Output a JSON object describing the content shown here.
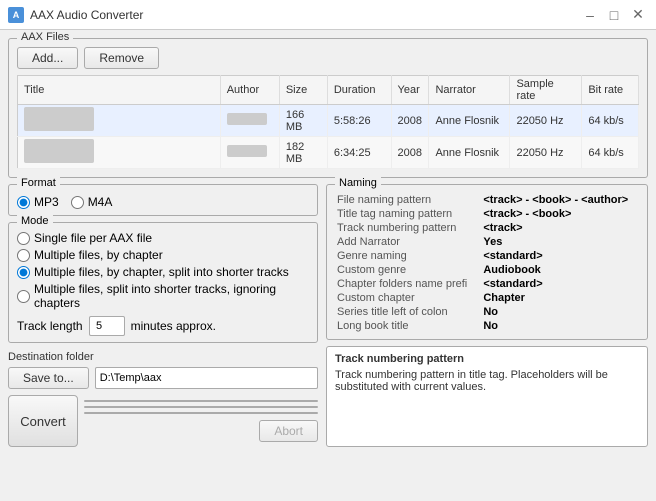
{
  "titleBar": {
    "title": "AAX Audio Converter",
    "icon": "A",
    "minimizeLabel": "–",
    "maximizeLabel": "□",
    "closeLabel": "✕"
  },
  "aaxFiles": {
    "groupLabel": "AAX Files",
    "addButton": "Add...",
    "removeButton": "Remove"
  },
  "table": {
    "columns": [
      "Title",
      "Author",
      "Size",
      "Duration",
      "Year",
      "Narrator",
      "Sample rate",
      "Bit rate"
    ],
    "rows": [
      {
        "title": "",
        "author": "",
        "size": "166 MB",
        "duration": "5:58:26",
        "year": "2008",
        "narrator": "Anne Flosnik",
        "sampleRate": "22050 Hz",
        "bitRate": "64 kb/s"
      },
      {
        "title": "",
        "author": "",
        "size": "182 MB",
        "duration": "6:34:25",
        "year": "2008",
        "narrator": "Anne Flosnik",
        "sampleRate": "22050 Hz",
        "bitRate": "64 kb/s"
      }
    ]
  },
  "format": {
    "groupLabel": "Format",
    "options": [
      "MP3",
      "M4A"
    ],
    "selected": "MP3"
  },
  "mode": {
    "groupLabel": "Mode",
    "options": [
      "Single file per AAX file",
      "Multiple files, by chapter",
      "Multiple files, by chapter, split into shorter tracks",
      "Multiple files, split into shorter tracks, ignoring chapters"
    ],
    "selected": 2
  },
  "trackLength": {
    "label": "Track length",
    "value": "5",
    "suffix": "minutes approx."
  },
  "destination": {
    "label": "Destination folder",
    "saveButton": "Save to...",
    "path": "D:\\Temp\\aax"
  },
  "naming": {
    "groupLabel": "Naming",
    "rows": [
      {
        "key": "File naming pattern",
        "value": "<track> - <book> - <author>",
        "disabled": false
      },
      {
        "key": "Title tag naming pattern",
        "value": "<track> - <book>",
        "disabled": false
      },
      {
        "key": "Track numbering pattern",
        "value": "<track>",
        "disabled": false
      },
      {
        "key": "Add Narrator",
        "value": "Yes",
        "disabled": false
      },
      {
        "key": "Genre naming",
        "value": "<standard>",
        "disabled": false
      },
      {
        "key": "Custom genre",
        "value": "Audiobook",
        "disabled": false
      },
      {
        "key": "Chapter folders name prefi",
        "value": "<standard>",
        "disabled": false
      },
      {
        "key": "Custom chapter",
        "value": "Chapter",
        "disabled": false
      },
      {
        "key": "Series title left of colon",
        "value": "No",
        "disabled": false
      },
      {
        "key": "Long book title",
        "value": "No",
        "disabled": false
      }
    ]
  },
  "infoBox": {
    "title": "Track numbering pattern",
    "description": "Track numbering pattern in title tag. Placeholders will be substituted with current values."
  },
  "convertButton": "Convert",
  "abortButton": "Abort"
}
